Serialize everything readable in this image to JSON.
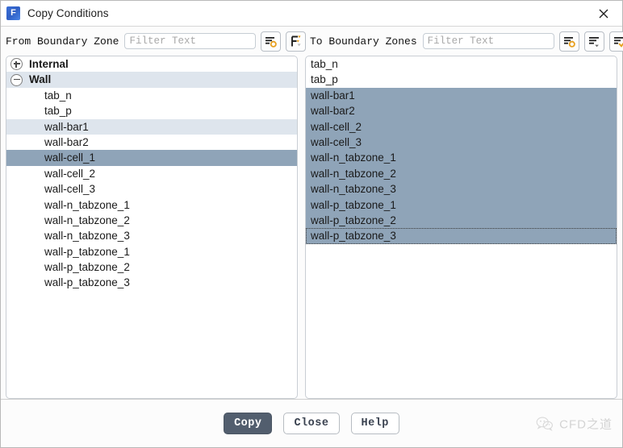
{
  "window": {
    "title": "Copy Conditions",
    "app_icon": "fluent-f-icon",
    "close_icon": "close-icon"
  },
  "colors": {
    "selection": "#8fa4b8",
    "hover": "#dee5ed",
    "accent_orange": "#e8a020",
    "primary_button": "#525e6e",
    "panel_border": "#c9ced4"
  },
  "from_panel": {
    "label": "From Boundary Zone",
    "filter": {
      "value": "",
      "placeholder": "Filter Text"
    },
    "tools": [
      {
        "name": "list-options-icon",
        "icon": "lines-circle"
      },
      {
        "name": "filter-icon",
        "icon": "f-filter"
      }
    ],
    "tree": [
      {
        "label": "Internal",
        "type": "group",
        "expanded": false,
        "state": "normal"
      },
      {
        "label": "Wall",
        "type": "group",
        "expanded": true,
        "state": "hover"
      },
      {
        "label": "tab_n",
        "type": "child",
        "state": "normal"
      },
      {
        "label": "tab_p",
        "type": "child",
        "state": "normal"
      },
      {
        "label": "wall-bar1",
        "type": "child",
        "state": "hover"
      },
      {
        "label": "wall-bar2",
        "type": "child",
        "state": "normal"
      },
      {
        "label": "wall-cell_1",
        "type": "child",
        "state": "selected"
      },
      {
        "label": "wall-cell_2",
        "type": "child",
        "state": "normal"
      },
      {
        "label": "wall-cell_3",
        "type": "child",
        "state": "normal"
      },
      {
        "label": "wall-n_tabzone_1",
        "type": "child",
        "state": "normal"
      },
      {
        "label": "wall-n_tabzone_2",
        "type": "child",
        "state": "normal"
      },
      {
        "label": "wall-n_tabzone_3",
        "type": "child",
        "state": "normal"
      },
      {
        "label": "wall-p_tabzone_1",
        "type": "child",
        "state": "normal"
      },
      {
        "label": "wall-p_tabzone_2",
        "type": "child",
        "state": "normal"
      },
      {
        "label": "wall-p_tabzone_3",
        "type": "child",
        "state": "normal"
      }
    ]
  },
  "to_panel": {
    "label": "To Boundary Zones",
    "filter": {
      "value": "",
      "placeholder": "Filter Text"
    },
    "tools": [
      {
        "name": "list-options-icon",
        "icon": "lines-circle"
      },
      {
        "name": "sort-dropdown-icon",
        "icon": "lines-caret"
      },
      {
        "name": "select-all-icon",
        "icon": "lines-check"
      },
      {
        "name": "deselect-all-icon",
        "icon": "lines-cross"
      }
    ],
    "items": [
      {
        "label": "tab_n",
        "state": "normal"
      },
      {
        "label": "tab_p",
        "state": "normal"
      },
      {
        "label": "wall-bar1",
        "state": "selected"
      },
      {
        "label": "wall-bar2",
        "state": "selected"
      },
      {
        "label": "wall-cell_2",
        "state": "selected"
      },
      {
        "label": "wall-cell_3",
        "state": "selected"
      },
      {
        "label": "wall-n_tabzone_1",
        "state": "selected"
      },
      {
        "label": "wall-n_tabzone_2",
        "state": "selected"
      },
      {
        "label": "wall-n_tabzone_3",
        "state": "selected"
      },
      {
        "label": "wall-p_tabzone_1",
        "state": "selected"
      },
      {
        "label": "wall-p_tabzone_2",
        "state": "selected"
      },
      {
        "label": "wall-p_tabzone_3",
        "state": "selected-focused"
      }
    ]
  },
  "footer": {
    "buttons": [
      {
        "label": "Copy",
        "name": "copy-button",
        "style": "primary"
      },
      {
        "label": "Close",
        "name": "close-button",
        "style": "default"
      },
      {
        "label": "Help",
        "name": "help-button",
        "style": "default"
      }
    ],
    "watermark": {
      "text": "CFD之道",
      "icon": "wechat-icon"
    }
  }
}
